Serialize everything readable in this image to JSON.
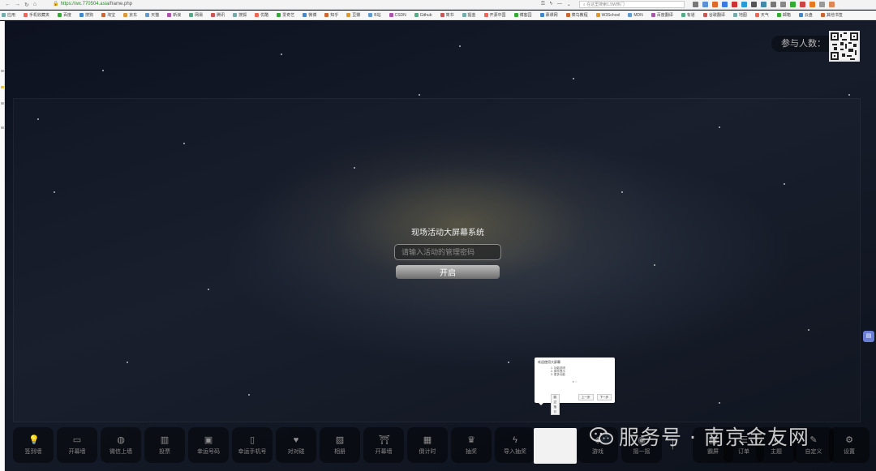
{
  "browser": {
    "url_host": "https://wx.770504.asia",
    "url_path": "/frame.php",
    "search_placeholder": "在这里搜索1.5W热门"
  },
  "bookmarks": [
    "应用",
    "手机收藏夹",
    "百度",
    "搜狗",
    "淘宝",
    "京东",
    "天猫",
    "新浪",
    "网易",
    "腾讯",
    "搜狐",
    "优酷",
    "爱奇艺",
    "微博",
    "知乎",
    "豆瓣",
    "B站",
    "CSDN",
    "Github",
    "简书",
    "掘金",
    "开源中国",
    "博客园",
    "慕课网",
    "菜鸟教程",
    "W3School",
    "MDN",
    "百度翻译",
    "有道",
    "谷歌翻译",
    "地图",
    "天气",
    "邮箱",
    "云盘",
    "其他书签"
  ],
  "header": {
    "participants_label": "参与人数："
  },
  "login": {
    "title": "现场活动大屏幕系统",
    "password_placeholder": "请输入活动的管理密码",
    "start_label": "开启"
  },
  "tour": {
    "title": "欢迎使用大屏幕",
    "lines": [
      "1. 功能说明",
      "2. 操作提示",
      "3. 更多功能"
    ],
    "skip_label": "跳过指引",
    "prev_label": "上一步",
    "next_label": "下一步"
  },
  "toolbar": {
    "items": [
      {
        "label": "签到墙",
        "icon": "bulb-icon"
      },
      {
        "label": "开幕墙",
        "icon": "screen-icon"
      },
      {
        "label": "微信上墙",
        "icon": "wechat-icon"
      },
      {
        "label": "投票",
        "icon": "bar-chart-icon"
      },
      {
        "label": "幸运号码",
        "icon": "ticket-icon"
      },
      {
        "label": "幸运手机号",
        "icon": "phone-icon"
      },
      {
        "label": "对对碰",
        "icon": "hearts-icon"
      },
      {
        "label": "相册",
        "icon": "photo-icon"
      },
      {
        "label": "开幕墙",
        "icon": "gate-icon"
      },
      {
        "label": "倒计时",
        "icon": "calendar-icon"
      },
      {
        "label": "抽奖",
        "icon": "trophy-icon"
      },
      {
        "label": "导入抽奖",
        "icon": "bolt-icon"
      },
      {
        "label": "",
        "icon": "blank-icon"
      },
      {
        "label": "游戏",
        "icon": "game-icon"
      },
      {
        "label": "摇一摇",
        "icon": "shake-icon"
      },
      {
        "label": "",
        "icon": "bar-icon"
      },
      {
        "label": "霸屏",
        "icon": "gift-icon"
      },
      {
        "label": "订单",
        "icon": "order-icon"
      },
      {
        "label": "主题",
        "icon": "theme-icon"
      },
      {
        "label": "自定义",
        "icon": "custom-icon"
      },
      {
        "label": "设置",
        "icon": "gear-icon"
      }
    ]
  },
  "watermark": {
    "text": "服务号 · 南京金友网"
  },
  "colors": {
    "start_button_top": "#bdbdbd",
    "start_button_bottom": "#6e6e6e",
    "float_button": "#6a7fd4"
  }
}
